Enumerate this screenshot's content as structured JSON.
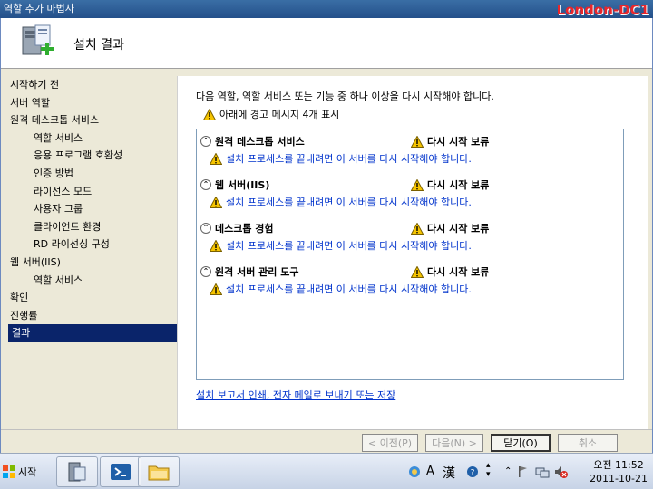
{
  "window": {
    "title": "역할 추가 마법사",
    "server_tag": "London-DC1"
  },
  "header": {
    "title": "설치 결과"
  },
  "sidebar": {
    "items": [
      {
        "label": "시작하기 전",
        "level": 0,
        "active": false
      },
      {
        "label": "서버 역할",
        "level": 0,
        "active": false
      },
      {
        "label": "원격 데스크톱 서비스",
        "level": 0,
        "active": false
      },
      {
        "label": "역할 서비스",
        "level": 1,
        "active": false
      },
      {
        "label": "응용 프로그램 호환성",
        "level": 1,
        "active": false
      },
      {
        "label": "인증 방법",
        "level": 1,
        "active": false
      },
      {
        "label": "라이선스 모드",
        "level": 1,
        "active": false
      },
      {
        "label": "사용자 그룹",
        "level": 1,
        "active": false
      },
      {
        "label": "클라이언트 환경",
        "level": 1,
        "active": false
      },
      {
        "label": "RD 라이선싱 구성",
        "level": 1,
        "active": false
      },
      {
        "label": "웹 서버(IIS)",
        "level": 0,
        "active": false
      },
      {
        "label": "역할 서비스",
        "level": 1,
        "active": false
      },
      {
        "label": "확인",
        "level": 0,
        "active": false
      },
      {
        "label": "진행률",
        "level": 0,
        "active": false
      },
      {
        "label": "결과",
        "level": 0,
        "active": true
      }
    ]
  },
  "main": {
    "intro": "다음 역할, 역할 서비스 또는 기능 중 하나 이상을 다시 시작해야 합니다.",
    "warning_summary": "아래에 경고 메시지 4개 표시",
    "results": [
      {
        "name": "원격 데스크톱 서비스",
        "status": "다시 시작 보류",
        "message": "설치 프로세스를 끝내려면 이 서버를 다시 시작해야 합니다."
      },
      {
        "name": "웹 서버(IIS)",
        "status": "다시 시작 보류",
        "message": "설치 프로세스를 끝내려면 이 서버를 다시 시작해야 합니다."
      },
      {
        "name": "데스크톱 경험",
        "status": "다시 시작 보류",
        "message": "설치 프로세스를 끝내려면 이 서버를 다시 시작해야 합니다."
      },
      {
        "name": "원격 서버 관리 도구",
        "status": "다시 시작 보류",
        "message": "설치 프로세스를 끝내려면 이 서버를 다시 시작해야 합니다."
      }
    ],
    "print_link": "설치 보고서 인쇄, 전자 메일로 보내기 또는 저장"
  },
  "buttons": {
    "previous": "< 이전(P)",
    "next": "다음(N) >",
    "close": "닫기(O)",
    "cancel": "취소"
  },
  "taskbar": {
    "start_label": "시작",
    "ime_char": "A",
    "hanja_char": "漢",
    "clock_time": "오전 11:52",
    "clock_date": "2011-10-21"
  },
  "colors": {
    "accent": "#0a246a",
    "link": "#0033cc",
    "server_tag": "#e8262b"
  }
}
